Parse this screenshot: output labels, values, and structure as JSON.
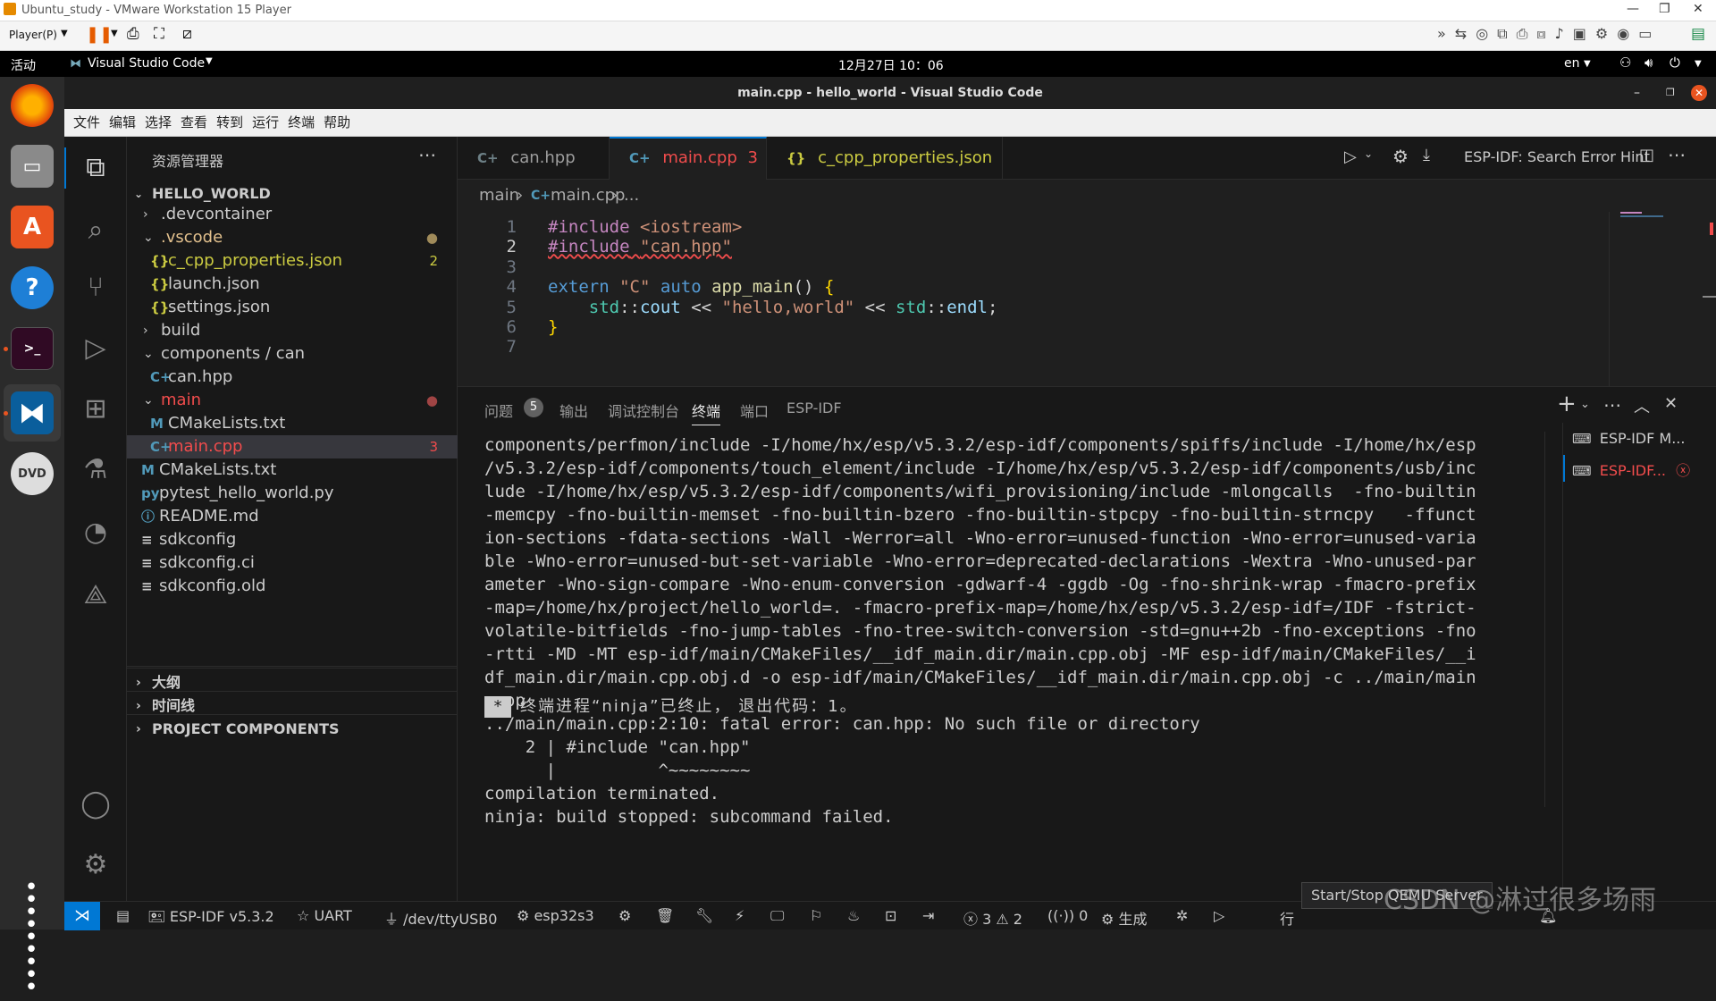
{
  "vm": {
    "title": "Ubuntu_study - VMware Workstation 15 Player",
    "player_menu": "Player(P)"
  },
  "gnome": {
    "activities": "活动",
    "app_name": "Visual Studio Code",
    "clock": "12月27日 10：06",
    "lang": "en"
  },
  "vscode": {
    "window_title": "main.cpp - hello_world - Visual Studio Code",
    "menu": [
      "文件",
      "编辑",
      "选择",
      "查看",
      "转到",
      "运行",
      "终端",
      "帮助"
    ]
  },
  "explorer": {
    "title": "资源管理器",
    "root": "HELLO_WORLD",
    "items": [
      {
        "label": ".devcontainer",
        "icon": "",
        "badge": ""
      },
      {
        "label": ".vscode",
        "icon": "",
        "badge": "●"
      },
      {
        "label": "c_cpp_properties.json",
        "icon": "{}",
        "badge": "2"
      },
      {
        "label": "launch.json",
        "icon": "{}",
        "badge": ""
      },
      {
        "label": "settings.json",
        "icon": "{}",
        "badge": ""
      },
      {
        "label": "build",
        "icon": "",
        "badge": ""
      },
      {
        "label": "components / can",
        "icon": "",
        "badge": ""
      },
      {
        "label": "can.hpp",
        "icon": "C+",
        "badge": ""
      },
      {
        "label": "main",
        "icon": "",
        "badge": "●"
      },
      {
        "label": "CMakeLists.txt",
        "icon": "M",
        "badge": ""
      },
      {
        "label": "main.cpp",
        "icon": "C+",
        "badge": "3"
      },
      {
        "label": "CMakeLists.txt",
        "icon": "M",
        "badge": ""
      },
      {
        "label": "pytest_hello_world.py",
        "icon": "py",
        "badge": ""
      },
      {
        "label": "README.md",
        "icon": "ⓘ",
        "badge": ""
      },
      {
        "label": "sdkconfig",
        "icon": "≡",
        "badge": ""
      },
      {
        "label": "sdkconfig.ci",
        "icon": "≡",
        "badge": ""
      },
      {
        "label": "sdkconfig.old",
        "icon": "≡",
        "badge": ""
      }
    ],
    "sections": [
      "大纲",
      "时间线",
      "PROJECT COMPONENTS"
    ]
  },
  "tabs": [
    {
      "icon": "C+",
      "label": "can.hpp",
      "badge": ""
    },
    {
      "icon": "C+",
      "label": "main.cpp",
      "badge": "3"
    },
    {
      "icon": "{}",
      "label": "c_cpp_properties.json",
      "badge": "2"
    }
  ],
  "editor_actions": {
    "hint": "ESP-IDF: Search Error Hint"
  },
  "breadcrumb": {
    "folder": "main",
    "file": "main.cpp",
    "more": "..."
  },
  "code_lines": [
    {
      "n": "1",
      "text": "#include <iostream>"
    },
    {
      "n": "2",
      "text": "#include \"can.hpp\""
    },
    {
      "n": "3",
      "text": ""
    },
    {
      "n": "4",
      "text": "extern \"C\" auto app_main() {"
    },
    {
      "n": "5",
      "text": "    std::cout << \"hello,world\" << std::endl;"
    },
    {
      "n": "6",
      "text": "}"
    },
    {
      "n": "7",
      "text": ""
    }
  ],
  "panel": {
    "tabs": [
      "问题",
      "输出",
      "调试控制台",
      "终端",
      "端口",
      "ESP-IDF"
    ],
    "problems_count": "5",
    "terminal_output": "components/perfmon/include -I/home/hx/esp/v5.3.2/esp-idf/components/spiffs/include -I/home/hx/esp\n/v5.3.2/esp-idf/components/touch_element/include -I/home/hx/esp/v5.3.2/esp-idf/components/usb/inc\nlude -I/home/hx/esp/v5.3.2/esp-idf/components/wifi_provisioning/include -mlongcalls  -fno-builtin\n-memcpy -fno-builtin-memset -fno-builtin-bzero -fno-builtin-stpcpy -fno-builtin-strncpy   -ffunct\nion-sections -fdata-sections -Wall -Werror=all -Wno-error=unused-function -Wno-error=unused-varia\nble -Wno-error=unused-but-set-variable -Wno-error=deprecated-declarations -Wextra -Wno-unused-par\nameter -Wno-sign-compare -Wno-enum-conversion -gdwarf-4 -ggdb -Og -fno-shrink-wrap -fmacro-prefix\n-map=/home/hx/project/hello_world=. -fmacro-prefix-map=/home/hx/esp/v5.3.2/esp-idf=/IDF -fstrict-\nvolatile-bitfields -fno-jump-tables -fno-tree-switch-conversion -std=gnu++2b -fno-exceptions -fno\n-rtti -MD -MT esp-idf/main/CMakeFiles/__idf_main.dir/main.cpp.obj -MF esp-idf/main/CMakeFiles/__i\ndf_main.dir/main.cpp.obj.d -o esp-idf/main/CMakeFiles/__idf_main.dir/main.cpp.obj -c ../main/main\n.cpp\n../main/main.cpp:2:10: fatal error: can.hpp: No such file or directory\n    2 | #include \"can.hpp\"\n      |          ^~~~~~~~~\ncompilation terminated.\nninja: build stopped: subcommand failed.",
    "terminal_end_star": "*",
    "terminal_end_text": "终端进程“ninja”已终止， 退出代码：1。",
    "terminals": [
      "ESP-IDF M...",
      "ESP-IDF..."
    ]
  },
  "status": {
    "esp_idf": "ESP-IDF v5.3.2",
    "uart": "UART",
    "port": "/dev/ttyUSB0",
    "target": "esp32s3",
    "errors": "3",
    "warnings": "2",
    "signal": "0",
    "build": "生成",
    "tooltip": "Start/Stop QEMU Server",
    "right_text": "行"
  },
  "watermark": "CSDN @淋过很多场雨",
  "colors": {
    "accent": "#0078d4",
    "error": "#f14c4c",
    "modified": "#e2c08d",
    "json": "#cbcb41",
    "keyword": "#569cd6",
    "string": "#ce9178",
    "directive": "#c586c0",
    "func": "#dcdcaa",
    "type": "#4ec9b0"
  }
}
